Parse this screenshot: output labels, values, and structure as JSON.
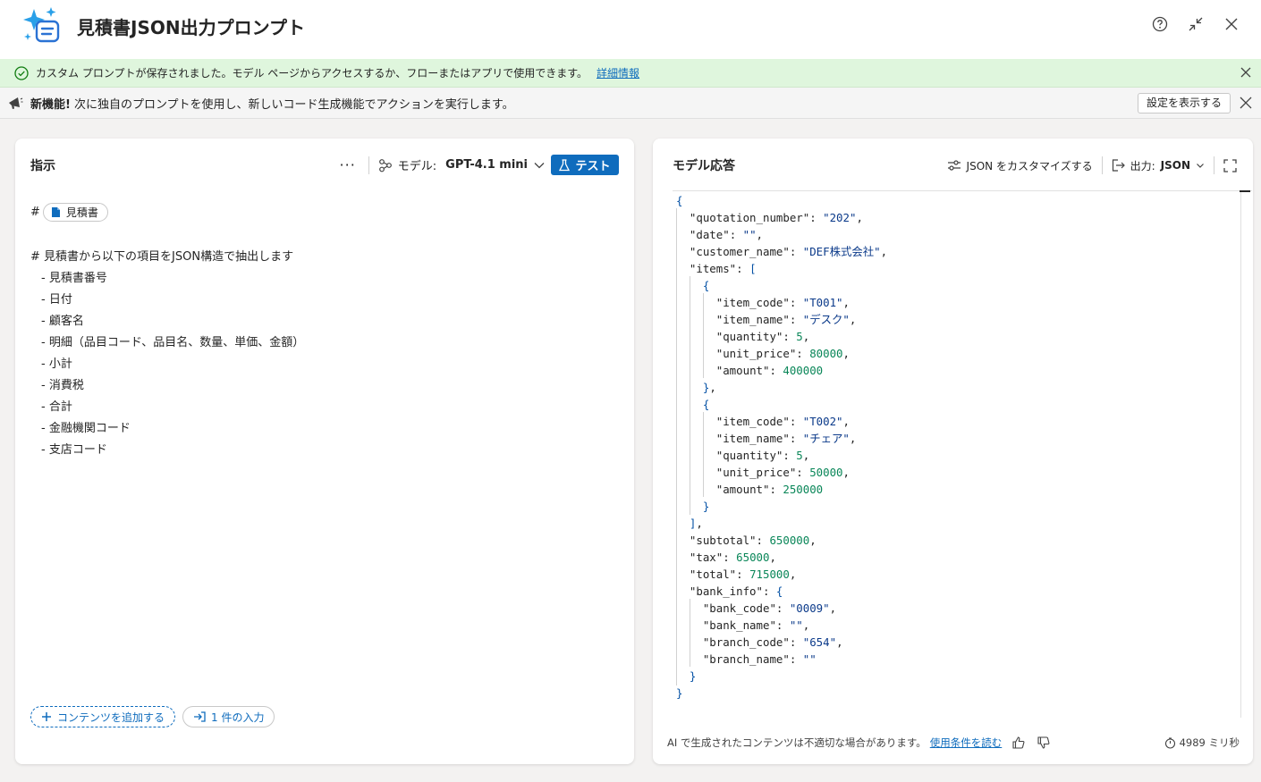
{
  "app": {
    "title": "見積書JSON出力プロンプト"
  },
  "banners": {
    "success": {
      "text": "カスタム プロンプトが保存されました。モデル ページからアクセスするか、フローまたはアプリで使用できます。",
      "link": "詳細情報"
    },
    "new_feature": {
      "label": "新機能!",
      "text": "次に独自のプロンプトを使用し、新しいコード生成機能でアクションを実行します。",
      "button": "設定を表示する"
    }
  },
  "left_panel": {
    "title": "指示",
    "more": "···",
    "model_label": "モデル:",
    "model_value": "GPT-4.1 mini",
    "test_button": "テスト",
    "ref_prefix": "#",
    "ref_chip": "見積書",
    "instruction_heading": "# 見積書から以下の項目をJSON構造で抽出します",
    "instruction_items": [
      "- 見積書番号",
      "- 日付",
      "- 顧客名",
      "- 明細（品目コード、品目名、数量、単価、金額）",
      "- 小計",
      "- 消費税",
      "- 合計",
      "- 金融機関コード",
      "- 支店コード"
    ],
    "add_content": "コンテンツを追加する",
    "inputs": "1 件の入力"
  },
  "right_panel": {
    "title": "モデル応答",
    "customize_json": "JSON をカスタマイズする",
    "output_label": "出力:",
    "output_value": "JSON",
    "response": {
      "quotation_number": "202",
      "date": "",
      "customer_name": "DEF株式会社",
      "items": [
        {
          "item_code": "T001",
          "item_name": "デスク",
          "quantity": 5,
          "unit_price": 80000,
          "amount": 400000
        },
        {
          "item_code": "T002",
          "item_name": "チェア",
          "quantity": 5,
          "unit_price": 50000,
          "amount": 250000
        }
      ],
      "subtotal": 650000,
      "tax": 65000,
      "total": 715000,
      "bank_info": {
        "bank_code": "0009",
        "bank_name": "",
        "branch_code": "654",
        "branch_name": ""
      }
    },
    "disclaimer": "AI で生成されたコンテンツは不適切な場合があります。",
    "terms_link": "使用条件を読む",
    "elapsed": "4989 ミリ秒"
  },
  "icons": {
    "logo": "copilot-prompt-icon",
    "help": "help-icon",
    "collapse": "collapse-icon",
    "close": "close-icon"
  },
  "colors": {
    "accent": "#0f6cbd",
    "success_bg": "#dff6dd",
    "success_icon": "#107c10"
  }
}
